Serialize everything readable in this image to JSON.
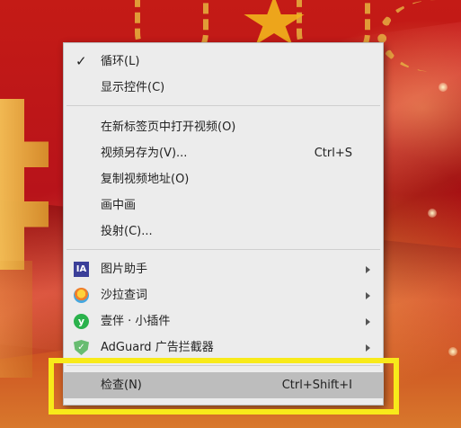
{
  "menu": {
    "items": [
      {
        "label": "循环(L)",
        "checked": true
      },
      {
        "label": "显示控件(C)"
      },
      {
        "label": "在新标签页中打开视频(O)"
      },
      {
        "label": "视频另存为(V)...",
        "shortcut": "Ctrl+S"
      },
      {
        "label": "复制视频地址(O)"
      },
      {
        "label": "画中画"
      },
      {
        "label": "投射(C)..."
      },
      {
        "label": "图片助手",
        "icon": "ia-icon",
        "icon_text": "IA",
        "submenu": true
      },
      {
        "label": "沙拉查词",
        "icon": "salad-icon",
        "submenu": true
      },
      {
        "label": "壹伴 · 小插件",
        "icon": "yiban-icon",
        "icon_text": "y",
        "submenu": true
      },
      {
        "label": "AdGuard 广告拦截器",
        "icon": "adguard-icon",
        "icon_text": "✓",
        "submenu": true
      },
      {
        "label": "检查(N)",
        "shortcut": "Ctrl+Shift+I",
        "highlighted": true
      }
    ],
    "check_mark": "✓"
  },
  "colors": {
    "highlight_box": "#f8ea1a",
    "menu_bg": "#ececec",
    "hover_bg": "#bdbdbd"
  }
}
